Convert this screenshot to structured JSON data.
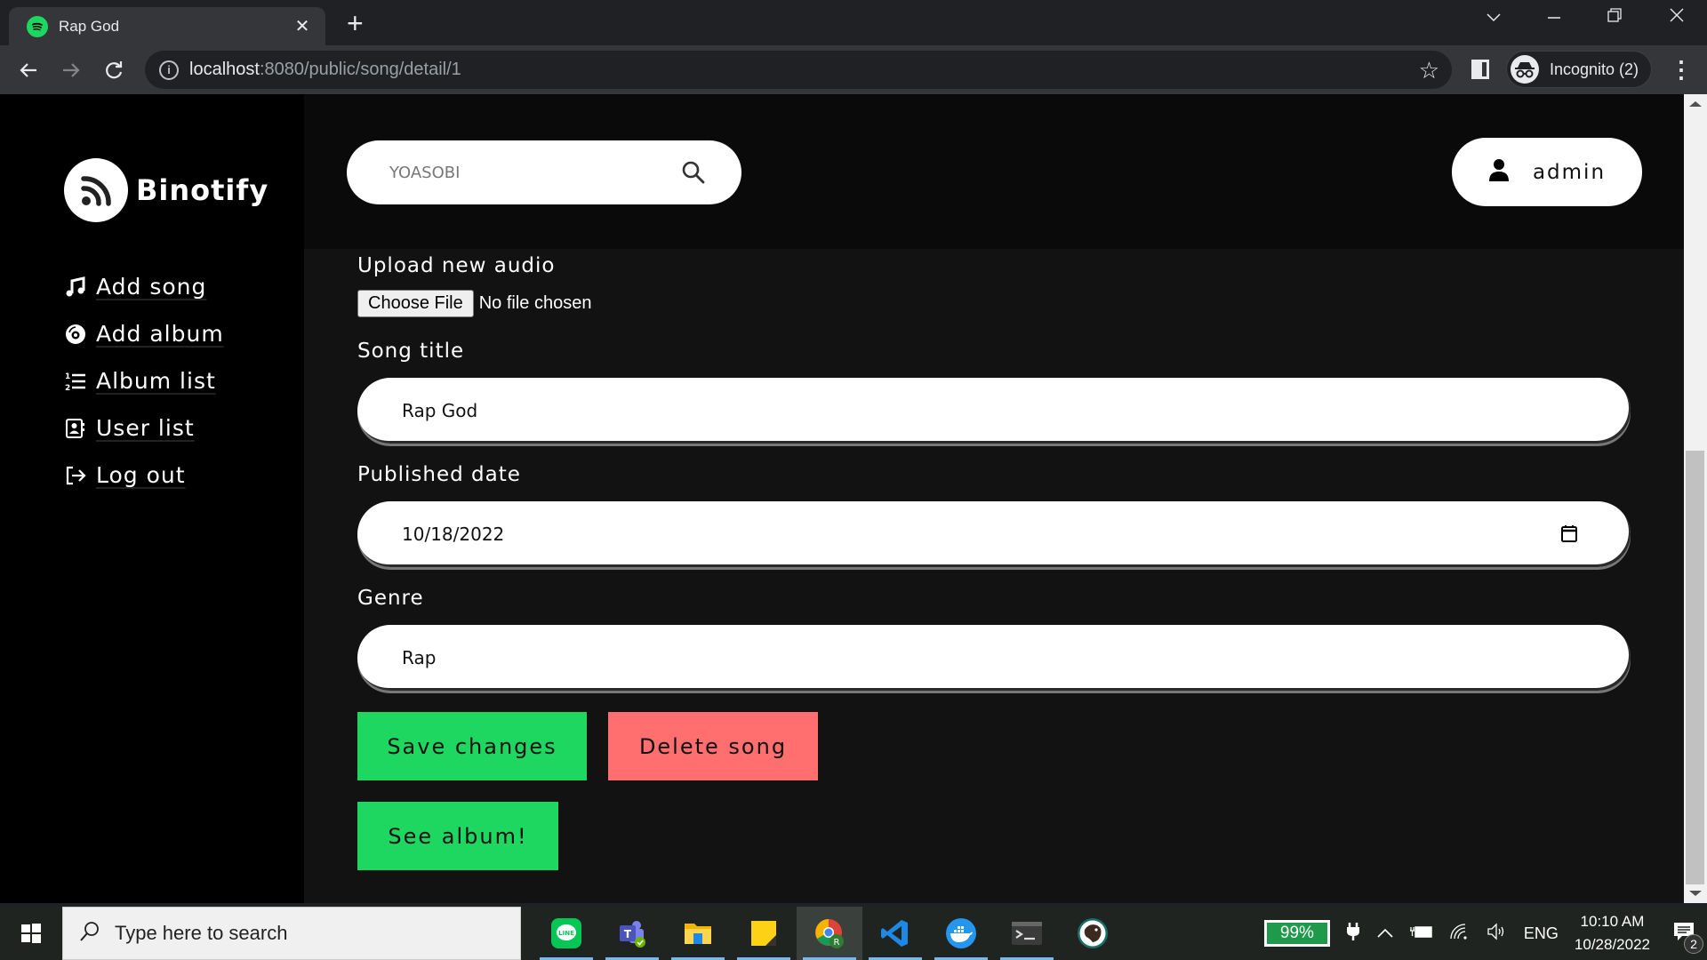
{
  "browser": {
    "tab_title": "Rap God",
    "url_host": "localhost",
    "url_rest": ":8080/public/song/detail/1",
    "profile_label": "Incognito (2)",
    "icons": [
      "spotify-favicon",
      "close-icon",
      "plus-icon",
      "chevron-down-icon",
      "minimize-icon",
      "restore-icon",
      "close-window-icon",
      "back-icon",
      "forward-icon",
      "reload-icon",
      "info-icon",
      "star-icon",
      "side-panel-icon",
      "incognito-icon",
      "kebab-icon"
    ]
  },
  "app": {
    "brand_name": "Binotify",
    "nav": [
      {
        "label": "Add song",
        "icon": "music-note-icon"
      },
      {
        "label": "Add album",
        "icon": "disc-icon"
      },
      {
        "label": "Album list",
        "icon": "numbered-list-icon"
      },
      {
        "label": "User list",
        "icon": "contact-card-icon"
      },
      {
        "label": "Log out",
        "icon": "logout-icon"
      }
    ],
    "search": {
      "placeholder": "YOASOBI",
      "value": ""
    },
    "user": {
      "label": "admin"
    }
  },
  "form": {
    "audio": {
      "label": "Upload new audio",
      "button": "Choose File",
      "status": "No file chosen"
    },
    "title": {
      "label": "Song title",
      "value": "Rap God"
    },
    "date": {
      "label": "Published date",
      "value": "10/18/2022"
    },
    "genre": {
      "label": "Genre",
      "value": "Rap"
    },
    "save_label": "Save changes",
    "delete_label": "Delete song",
    "see_album_label": "See album!",
    "colors": {
      "save": "#1ed760",
      "delete": "#ff6f6f"
    }
  },
  "taskbar": {
    "search_placeholder": "Type here to search",
    "apps": [
      "LINE",
      "Microsoft Teams",
      "File Explorer",
      "Sticky Notes",
      "Google Chrome",
      "Visual Studio Code",
      "Docker Desktop",
      "Terminal",
      "DBeaver"
    ],
    "battery": "99%",
    "language": "ENG",
    "time": "10:10 AM",
    "date": "10/28/2022",
    "notifications": "2"
  }
}
